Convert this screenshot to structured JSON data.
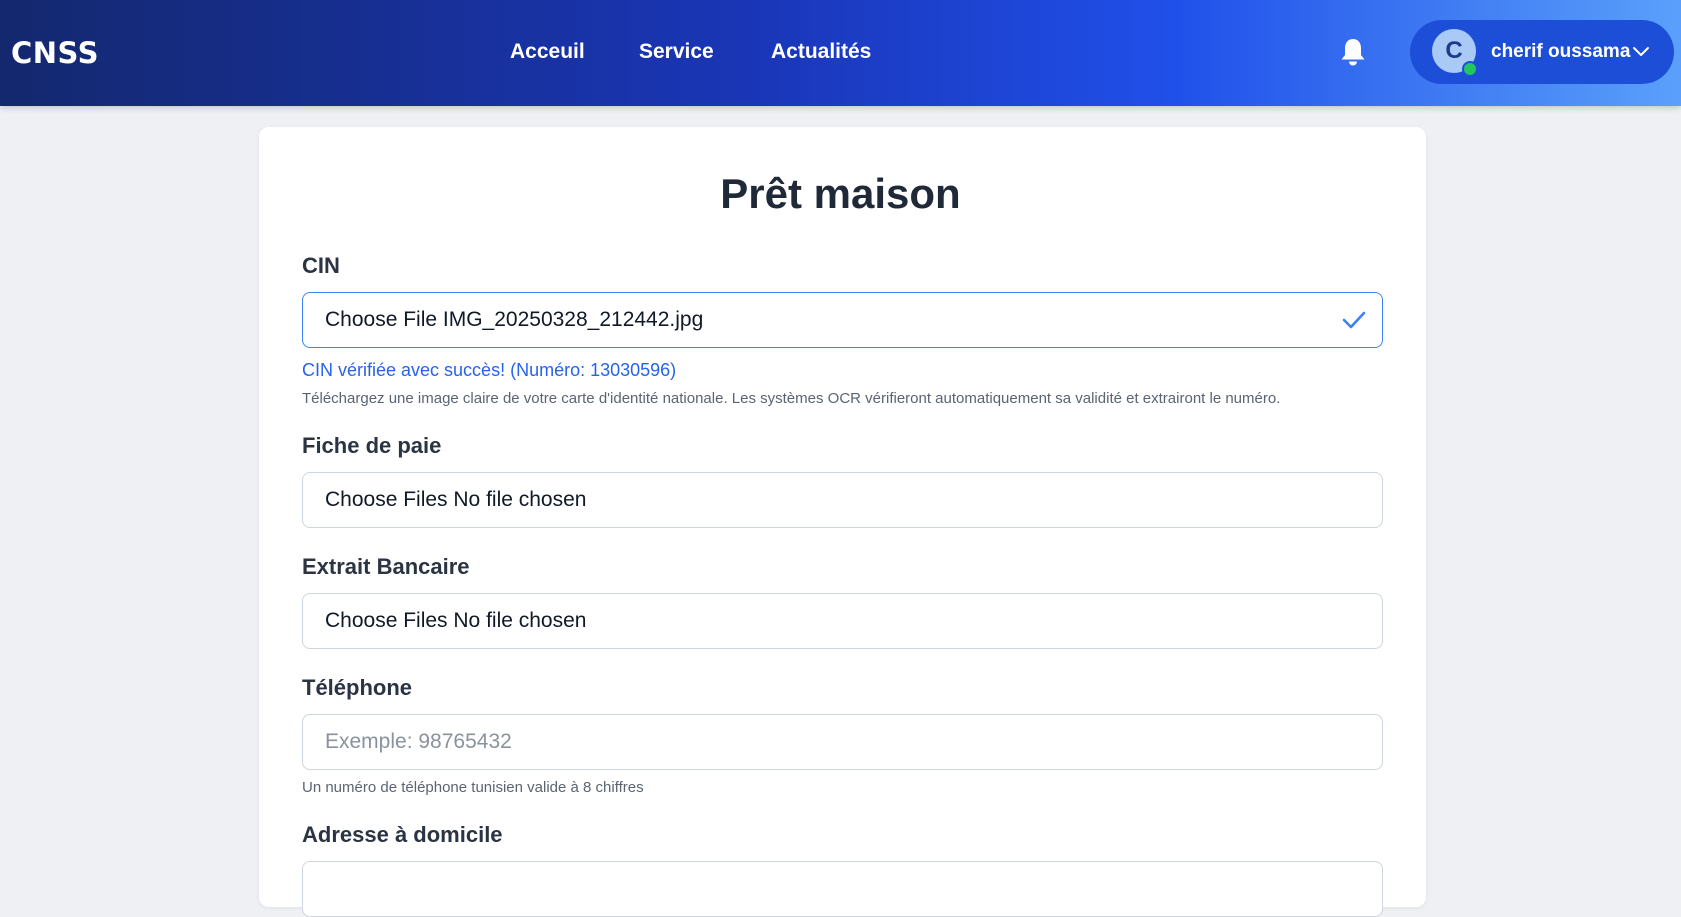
{
  "brand": {
    "logo": "CNSS"
  },
  "nav": {
    "links": [
      "Acceuil",
      "Service",
      "Actualités"
    ]
  },
  "user": {
    "initial": "C",
    "name": "cherif oussama",
    "status": "online",
    "status_color": "#22c55e"
  },
  "icons": {
    "notifications": "bell-icon",
    "user_menu": "chevron-down-icon",
    "cin_valid": "check-icon"
  },
  "form": {
    "title": "Prêt maison",
    "cin": {
      "label": "CIN",
      "file_text": "Choose File IMG_20250328_212442.jpg",
      "success": "CIN vérifiée avec succès! (Numéro: 13030596)",
      "help": "Téléchargez une image claire de votre carte d'identité nationale. Les systèmes OCR vérifieront automatiquement sa validité et extrairont le numéro."
    },
    "fiche": {
      "label": "Fiche de paie",
      "file_text": "Choose Files No file chosen"
    },
    "extrait": {
      "label": "Extrait Bancaire",
      "file_text": "Choose Files No file chosen"
    },
    "telephone": {
      "label": "Téléphone",
      "placeholder": "Exemple: 98765432",
      "help": "Un numéro de téléphone tunisien valide à 8 chiffres"
    },
    "adresse": {
      "label": "Adresse à domicile"
    }
  },
  "colors": {
    "accent": "#2563eb",
    "nav_gradient_start": "#14286e",
    "nav_gradient_end": "#5aa0fb"
  }
}
